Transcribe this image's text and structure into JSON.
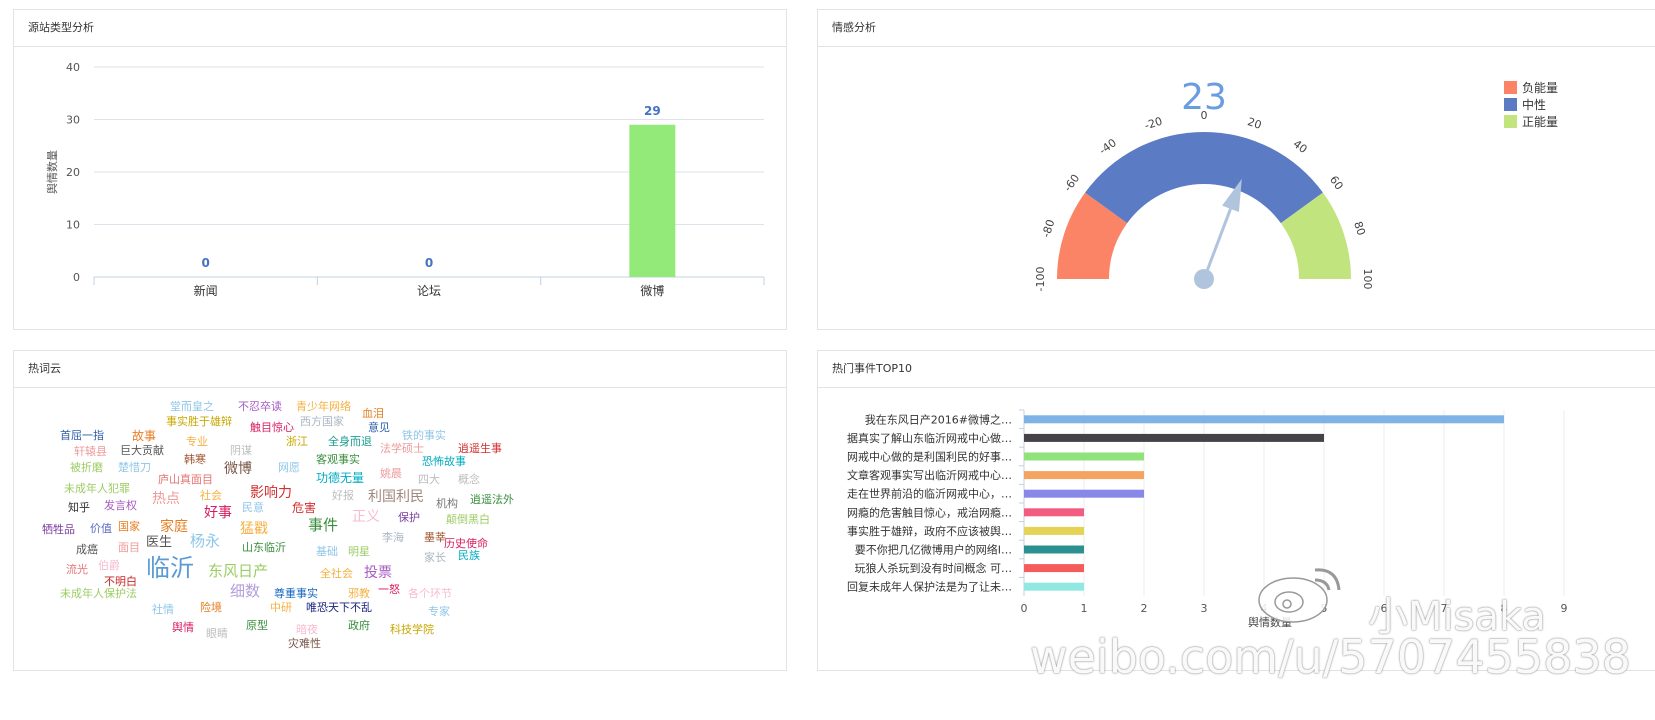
{
  "source_panel": {
    "title": "源站类型分析",
    "chart_data": {
      "type": "bar",
      "categories": [
        "新闻",
        "论坛",
        "微博"
      ],
      "values": [
        0,
        0,
        29
      ],
      "ylabel": "舆情数量",
      "ylim": [
        0,
        40
      ],
      "yticks": [
        0,
        10,
        20,
        30,
        40
      ],
      "bar_color": "#94ea78",
      "label_color": "#4472c4",
      "grid": true
    }
  },
  "sentiment_panel": {
    "title": "情感分析",
    "value": "23",
    "chart_data": {
      "type": "gauge",
      "value": 23,
      "range": [
        -100,
        100
      ],
      "ticks": [
        -100,
        -80,
        -60,
        -40,
        -20,
        0,
        20,
        40,
        60,
        80,
        100
      ],
      "bands": [
        {
          "name": "负能量",
          "from": -100,
          "to": -60,
          "color": "#fc8466"
        },
        {
          "name": "中性",
          "from": -60,
          "to": 60,
          "color": "#5b7bc4"
        },
        {
          "name": "正能量",
          "from": 60,
          "to": 100,
          "color": "#c2e47e"
        }
      ],
      "legend_position": "top-right"
    }
  },
  "wordcloud_panel": {
    "title": "热词云",
    "words": [
      {
        "text": "堂而皇之",
        "color": "#8ec6e8",
        "size": 11
      },
      {
        "text": "不忍卒读",
        "color": "#a75cc4",
        "size": 11
      },
      {
        "text": "青少年网络",
        "color": "#f5b041",
        "size": 11
      },
      {
        "text": "血泪",
        "color": "#e67e22",
        "size": 11
      },
      {
        "text": "事实胜于雄辩",
        "color": "#c8a800",
        "size": 11
      },
      {
        "text": "触目惊心",
        "color": "#d81b60",
        "size": 11
      },
      {
        "text": "西方国家",
        "color": "#aab7c4",
        "size": 11
      },
      {
        "text": "意见",
        "color": "#2e5fa8",
        "size": 11
      },
      {
        "text": "首屈一指",
        "color": "#2e5fa8",
        "size": 11
      },
      {
        "text": "故事",
        "color": "#e67e22",
        "size": 12
      },
      {
        "text": "铁的事实",
        "color": "#8ec6e8",
        "size": 11
      },
      {
        "text": "专业",
        "color": "#f5b041",
        "size": 11
      },
      {
        "text": "浙江",
        "color": "#c8a800",
        "size": 11
      },
      {
        "text": "全身而退",
        "color": "#1a9d8f",
        "size": 11
      },
      {
        "text": "法学硕士",
        "color": "#ef9a9a",
        "size": 11
      },
      {
        "text": "逍遥生事",
        "color": "#d32f2f",
        "size": 11
      },
      {
        "text": "轩辕县",
        "color": "#ef9a9a",
        "size": 11
      },
      {
        "text": "巨大贡献",
        "color": "#555555",
        "size": 11
      },
      {
        "text": "阴谋",
        "color": "#bdbdbd",
        "size": 11
      },
      {
        "text": "被折磨",
        "color": "#9ccc65",
        "size": 11
      },
      {
        "text": "楚惜刀",
        "color": "#8ec6e8",
        "size": 11
      },
      {
        "text": "韩寒",
        "color": "#a0522d",
        "size": 11
      },
      {
        "text": "微博",
        "color": "#795548",
        "size": 14
      },
      {
        "text": "网愿",
        "color": "#8ec6e8",
        "size": 11
      },
      {
        "text": "客观事实",
        "color": "#388e3c",
        "size": 11
      },
      {
        "text": "恐怖故事",
        "color": "#00acc1",
        "size": 11
      },
      {
        "text": "庐山真面目",
        "color": "#e57373",
        "size": 11
      },
      {
        "text": "功德无量",
        "color": "#00acc1",
        "size": 12
      },
      {
        "text": "姚晨",
        "color": "#ef9a9a",
        "size": 11
      },
      {
        "text": "四大",
        "color": "#bdbdbd",
        "size": 11
      },
      {
        "text": "概念",
        "color": "#bdbdbd",
        "size": 11
      },
      {
        "text": "未成年人犯罪",
        "color": "#9ccc65",
        "size": 11
      },
      {
        "text": "社会",
        "color": "#f5b041",
        "size": 11
      },
      {
        "text": "影响力",
        "color": "#d32f2f",
        "size": 14
      },
      {
        "text": "热点",
        "color": "#ef9a9a",
        "size": 14
      },
      {
        "text": "好报",
        "color": "#bdbdbd",
        "size": 11
      },
      {
        "text": "利国利民",
        "color": "#a1887f",
        "size": 14
      },
      {
        "text": "机构",
        "color": "#777777",
        "size": 11
      },
      {
        "text": "逍遥法外",
        "color": "#388e3c",
        "size": 11
      },
      {
        "text": "知乎",
        "color": "#333333",
        "size": 11
      },
      {
        "text": "发言权",
        "color": "#a75cc4",
        "size": 11
      },
      {
        "text": "好事",
        "color": "#d81b60",
        "size": 14
      },
      {
        "text": "民意",
        "color": "#8ec6e8",
        "size": 11
      },
      {
        "text": "危害",
        "color": "#d32f2f",
        "size": 12
      },
      {
        "text": "正义",
        "color": "#f8bbd0",
        "size": 14
      },
      {
        "text": "保护",
        "color": "#7b3fa0",
        "size": 11
      },
      {
        "text": "颠倒黑白",
        "color": "#9ccc65",
        "size": 11
      },
      {
        "text": "牺牲品",
        "color": "#7b3fa0",
        "size": 11
      },
      {
        "text": "价值",
        "color": "#5c6bc0",
        "size": 11
      },
      {
        "text": "国家",
        "color": "#e67e22",
        "size": 11
      },
      {
        "text": "家庭",
        "color": "#e67e22",
        "size": 14
      },
      {
        "text": "猛戳",
        "color": "#f5b041",
        "size": 14
      },
      {
        "text": "事件",
        "color": "#388e3c",
        "size": 15
      },
      {
        "text": "墨莘",
        "color": "#a0522d",
        "size": 11
      },
      {
        "text": "李海",
        "color": "#aab7c4",
        "size": 11
      },
      {
        "text": "历史使命",
        "color": "#d81b60",
        "size": 11
      },
      {
        "text": "成癌",
        "color": "#555555",
        "size": 11
      },
      {
        "text": "面目",
        "color": "#ef9a9a",
        "size": 11
      },
      {
        "text": "医生",
        "color": "#555555",
        "size": 13
      },
      {
        "text": "杨永",
        "color": "#8ec6e8",
        "size": 15
      },
      {
        "text": "山东临沂",
        "color": "#388e3c",
        "size": 11
      },
      {
        "text": "基础",
        "color": "#8ec6e8",
        "size": 11
      },
      {
        "text": "明星",
        "color": "#9ccc65",
        "size": 11
      },
      {
        "text": "家长",
        "color": "#aab7c4",
        "size": 11
      },
      {
        "text": "民族",
        "color": "#00acc1",
        "size": 11
      },
      {
        "text": "流光",
        "color": "#e57373",
        "size": 11
      },
      {
        "text": "伯爵",
        "color": "#f8bbd0",
        "size": 11
      },
      {
        "text": "临沂",
        "color": "#5b9bd5",
        "size": 24
      },
      {
        "text": "东风日产",
        "color": "#9ccc65",
        "size": 15
      },
      {
        "text": "全社会",
        "color": "#f5b041",
        "size": 11
      },
      {
        "text": "投票",
        "color": "#a75cc4",
        "size": 14
      },
      {
        "text": "不明白",
        "color": "#c62828",
        "size": 11
      },
      {
        "text": "细数",
        "color": "#b39ddb",
        "size": 15
      },
      {
        "text": "尊重事实",
        "color": "#1565c0",
        "size": 11
      },
      {
        "text": "邪教",
        "color": "#f5b041",
        "size": 11
      },
      {
        "text": "一怒",
        "color": "#d81b60",
        "size": 11
      },
      {
        "text": "各个环节",
        "color": "#f8bbd0",
        "size": 11
      },
      {
        "text": "未成年人保护法",
        "color": "#9ccc65",
        "size": 11
      },
      {
        "text": "社情",
        "color": "#8ec6e8",
        "size": 11
      },
      {
        "text": "险境",
        "color": "#e67e22",
        "size": 11
      },
      {
        "text": "中研",
        "color": "#f5b041",
        "size": 11
      },
      {
        "text": "唯恐天下不乱",
        "color": "#1a237e",
        "size": 11
      },
      {
        "text": "专家",
        "color": "#8ec6e8",
        "size": 11
      },
      {
        "text": "舆情",
        "color": "#d81b60",
        "size": 11
      },
      {
        "text": "眼睛",
        "color": "#bdbdbd",
        "size": 11
      },
      {
        "text": "原型",
        "color": "#388e3c",
        "size": 11
      },
      {
        "text": "暗夜",
        "color": "#f8bbd0",
        "size": 11
      },
      {
        "text": "政府",
        "color": "#388e3c",
        "size": 11
      },
      {
        "text": "科技学院",
        "color": "#c8a800",
        "size": 11
      },
      {
        "text": "灾难性",
        "color": "#795548",
        "size": 11
      }
    ]
  },
  "top10_panel": {
    "title": "热门事件TOP10",
    "chart_data": {
      "type": "bar",
      "orientation": "horizontal",
      "categories": [
        "我在东风日产2016#微博之…",
        "据真实了解山东临沂网戒中心做…",
        "网戒中心做的是利国利民的好事…",
        "文章客观事实写出临沂网戒中心…",
        "走在世界前沿的临沂网戒中心，…",
        "网瘾的危害触目惊心，戒治网瘾…",
        "事实胜于雄辩，政府不应该被舆…",
        "要不你把几亿微博用户的网络I…",
        "玩狼人杀玩到没有时间概念 可…",
        "回复未成年人保护法是为了让未…"
      ],
      "values": [
        8,
        5,
        2,
        2,
        2,
        1,
        1,
        1,
        1,
        1
      ],
      "colors": [
        "#7fb3e6",
        "#434348",
        "#8fe37a",
        "#f4a460",
        "#8888e8",
        "#f15c80",
        "#e4d354",
        "#2b908f",
        "#f45b5b",
        "#91e8e1"
      ],
      "xlabel": "舆情数量",
      "xticks": [
        0,
        1,
        2,
        3,
        4,
        5,
        6,
        7,
        8,
        9
      ],
      "xlim": [
        0,
        9
      ]
    }
  },
  "watermark": {
    "user": "小Misaka",
    "url": "weibo.com/u/5707455838"
  }
}
